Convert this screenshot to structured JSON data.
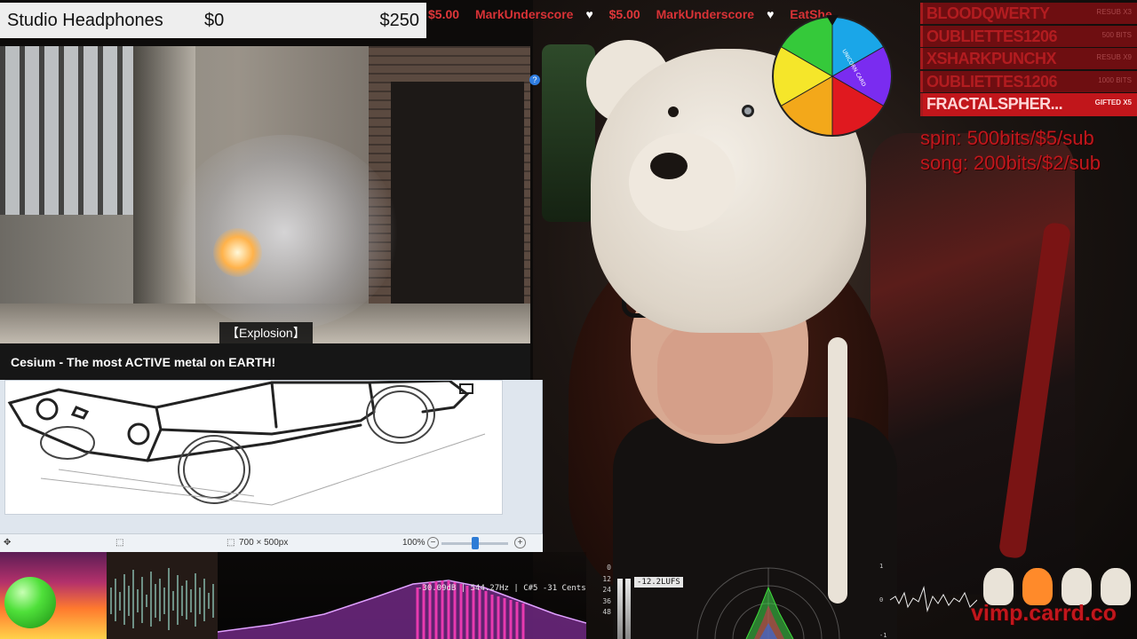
{
  "product": {
    "name": "Studio Headphones",
    "min": "$0",
    "max": "$250"
  },
  "ticker": [
    {
      "amount": "$5.00",
      "name": "",
      "heart": ""
    },
    {
      "amount": "",
      "name": "MarkUnderscore",
      "heart": "♥"
    },
    {
      "amount": "$5.00",
      "name": "",
      "heart": ""
    },
    {
      "amount": "",
      "name": "MarkUnderscore",
      "heart": "♥"
    },
    {
      "amount": "",
      "name": "EatShe",
      "heart": ""
    }
  ],
  "video": {
    "caption": "【Explosion】",
    "title": "Cesium - The most ACTIVE metal on EARTH!"
  },
  "drawing_app": {
    "canvas_size": "700 × 500px",
    "zoom": "100%",
    "zoom_fraction": 0.5
  },
  "sub_list": [
    {
      "name": "BLOODQWERTY",
      "note": "RESUB X3"
    },
    {
      "name": "OUBLIETTES1206",
      "note": "500 BITS"
    },
    {
      "name": "XSHARKPUNCHX",
      "note": "RESUB X9"
    },
    {
      "name": "OUBLIETTES1206",
      "note": "1000 BITS"
    },
    {
      "name": "FRACTALSPHER...",
      "note": "GIFTED X5"
    }
  ],
  "prices": {
    "spin": "spin: 500bits/$5/sub",
    "song": "song: 200bits/$2/sub"
  },
  "wheel": {
    "colors": [
      "#1aa6e8",
      "#7a2cf0",
      "#e0191f",
      "#f3a81a",
      "#f5e62a",
      "#35c93a"
    ],
    "label": "UNICORN CARD"
  },
  "visualizers": {
    "eq_readout": "-30.09dB | 544.27Hz | C#5 -31 Cents",
    "lufs": "-12.2LUFS",
    "meter_scale": [
      "0",
      "12",
      "24",
      "36",
      "48"
    ],
    "scope_scale": [
      "1",
      "0",
      "-1"
    ]
  },
  "watermark": "vimp.carrd.co"
}
